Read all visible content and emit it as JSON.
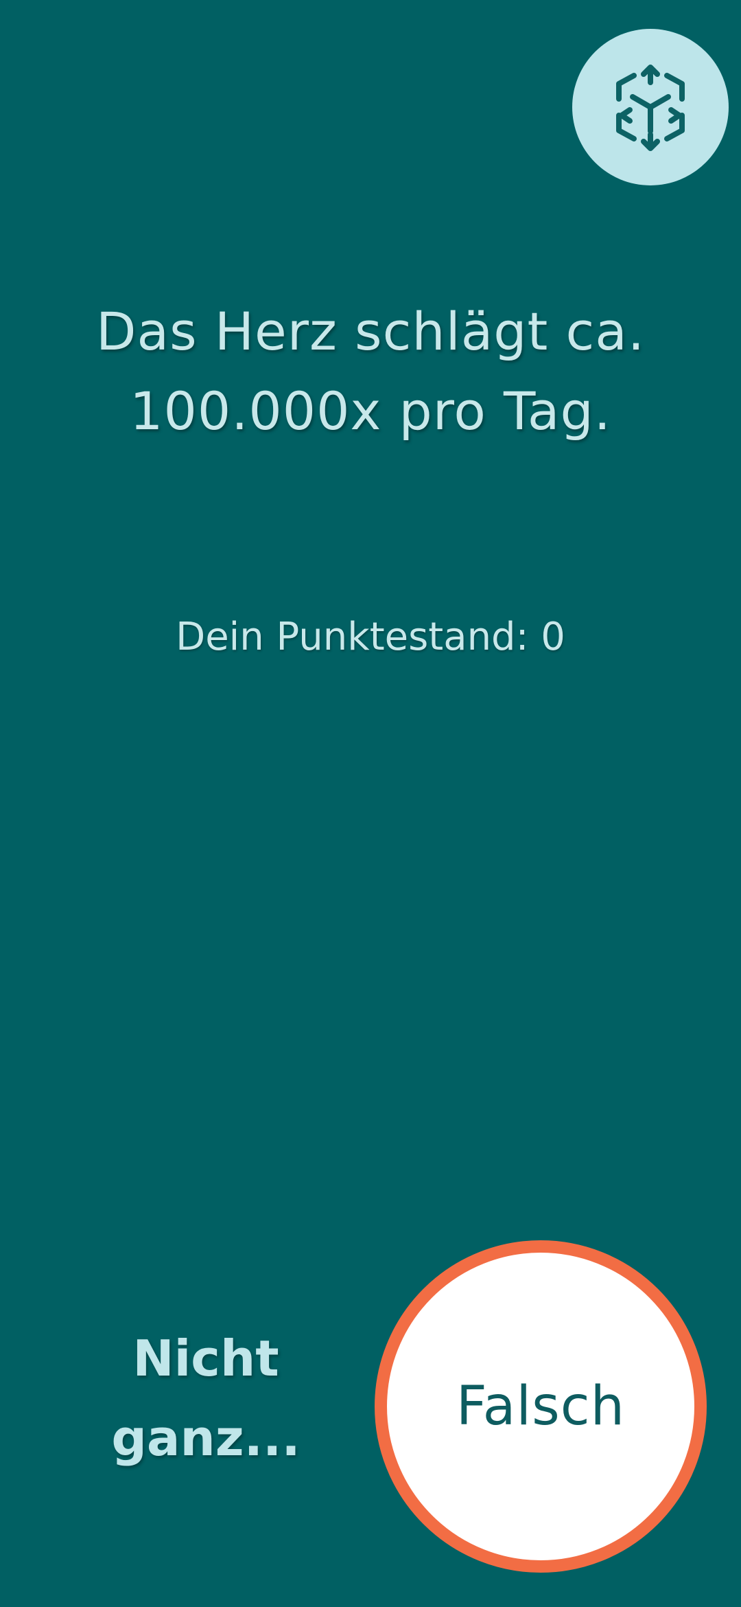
{
  "ar_button": {
    "icon": "cube-3d-icon"
  },
  "statement": {
    "line1": "Das Herz schlägt ca.",
    "line2": "100.000x pro Tag."
  },
  "score": {
    "text": "Dein Punktestand: 0"
  },
  "feedback": {
    "line1": "Nicht",
    "line2": "ganz..."
  },
  "answer_button": {
    "label": "Falsch"
  },
  "colors": {
    "background": "#016063",
    "text_light": "#c8e8ea",
    "ar_button_bg": "#bde5ea",
    "answer_ring": "#f26d44",
    "answer_text": "#0e5c60"
  }
}
